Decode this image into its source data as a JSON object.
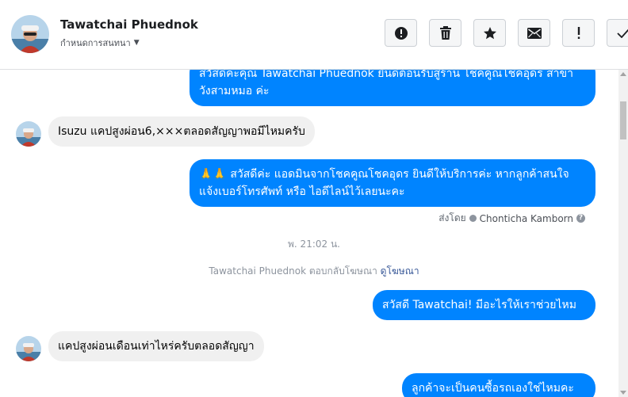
{
  "header": {
    "name": "Tawatchai Phuednok",
    "subtitle": "กำหนดการสนทนา",
    "actions": [
      "spam-report",
      "delete",
      "star",
      "mark-unread",
      "important",
      "done"
    ]
  },
  "messages": {
    "m1": "สวัสดีค่ะคุณ Tawatchai Phuednok ยินดีต้อนรับสู่ร้าน โชคคูณโชคอุดร สาขา วังสามหมอ ค่ะ",
    "m2": "Isuzu แคปสูงผ่อน6,×××ตลอดสัญญาพอมีไหมครับ",
    "m3": "🙏🙏 สวัสดีค่ะ แอดมินจากโชคคูณโชคอุดร ยินดีให้บริการค่ะ หากลูกค้าสนใจ แจ้งเบอร์โทรศัพท์ หรือ ไอดีไลน์ไว้เลยนะคะ",
    "sent_by_prefix": "ส่งโดย",
    "sent_by_agent": "Chonticha Kamborn",
    "timestamp": "พ. 21:02 น.",
    "replied_text": "Tawatchai Phuednok ตอบกลับโฆษณา",
    "replied_link": "ดูโฆษณา",
    "m4": "สวัสดี Tawatchai! มีอะไรให้เราช่วยไหม",
    "m5": "แคปสูงผ่อนเดือนเท่าไหร่ครับตลอดสัญญา",
    "m6": "ลูกค้าจะเป็นคนซื้อรถเองใช่ไหมคะ"
  },
  "colors": {
    "outgoing_bubble": "#0084ff",
    "incoming_bubble": "#f0f0f0"
  }
}
